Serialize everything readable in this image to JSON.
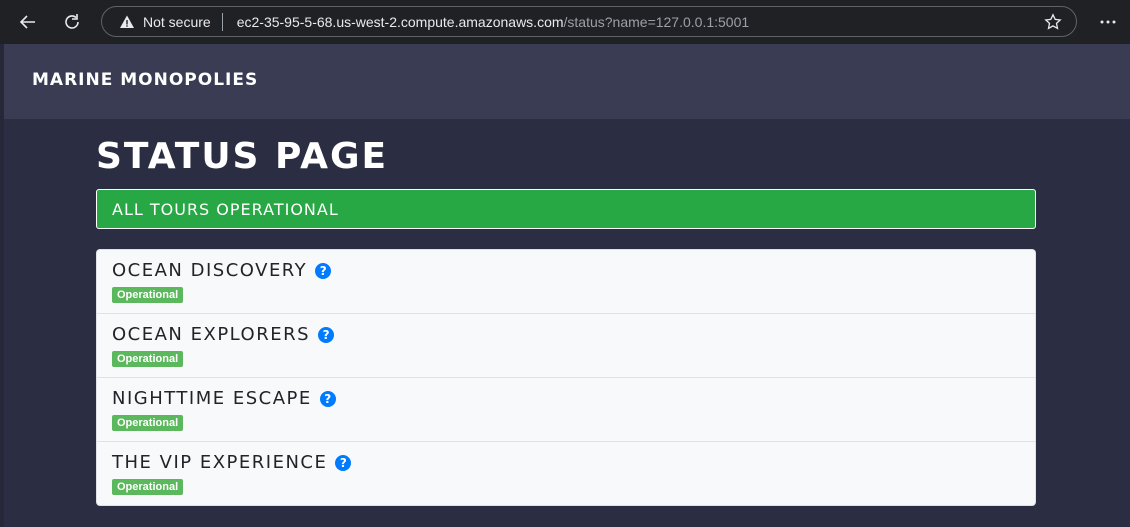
{
  "browser": {
    "security_label": "Not secure",
    "url_host": "ec2-35-95-5-68.us-west-2.compute.amazonaws.com",
    "url_rest": "/status?name=127.0.0.1:5001",
    "icons": [
      "back-icon",
      "reload-icon",
      "warning-icon",
      "star-icon",
      "more-icon"
    ]
  },
  "header": {
    "brand": "MARINE MONOPOLIES"
  },
  "main": {
    "title": "STATUS PAGE",
    "banner": "ALL TOURS OPERATIONAL",
    "tours": [
      {
        "name": "OCEAN DISCOVERY",
        "status": "Operational"
      },
      {
        "name": "OCEAN EXPLORERS",
        "status": "Operational"
      },
      {
        "name": "NIGHTTIME ESCAPE",
        "status": "Operational"
      },
      {
        "name": "THE VIP EXPERIENCE",
        "status": "Operational"
      }
    ]
  },
  "colors": {
    "background": "#2b2d42",
    "header": "#393c52",
    "banner": "#28a745",
    "badge": "#5cb85c",
    "help_icon": "#007bff"
  }
}
